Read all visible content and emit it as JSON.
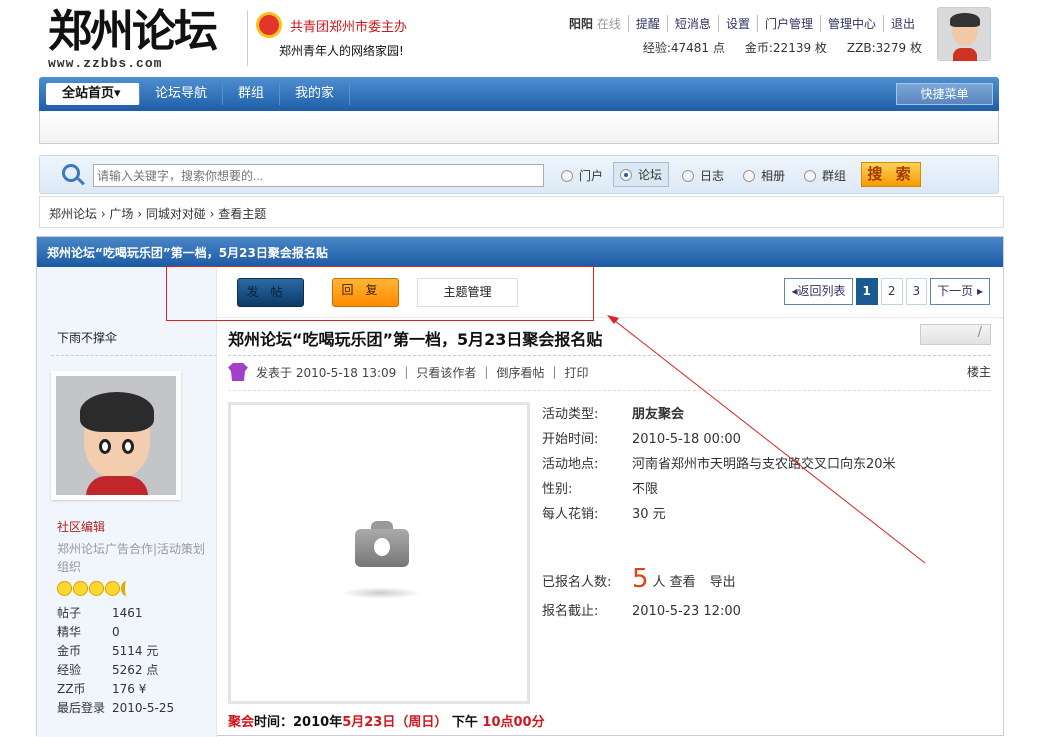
{
  "header": {
    "logo_text": "郑州论坛",
    "logo_url": "www.zzbbs.com",
    "org_line1": "共青团郑州市委主办",
    "org_line2": "郑州青年人的网络家园!",
    "user": {
      "name": "阳阳",
      "status": "在线",
      "links": [
        "提醒",
        "短消息",
        "设置",
        "门户管理",
        "管理中心",
        "退出"
      ],
      "exp": "经验:47481 点",
      "gold": "金币:22139 枚",
      "zzb": "ZZB:3279 枚"
    }
  },
  "nav": {
    "items": [
      "全站首页▾",
      "论坛导航",
      "群组",
      "我的家"
    ],
    "quick_menu": "快捷菜单"
  },
  "search": {
    "placeholder": "请输入关键字，搜索你想要的...",
    "options": [
      "门户",
      "论坛",
      "日志",
      "相册",
      "群组"
    ],
    "selected": "论坛",
    "button": "搜 索"
  },
  "breadcrumb": "郑州论坛 › 广场 › 同城对对碰 › 查看主题",
  "thread": {
    "header_title": "郑州论坛“吃喝玩乐团”第一档，5月23日聚会报名贴",
    "title": "郑州论坛“吃喝玩乐团”第一档，5月23日聚会报名贴",
    "buttons": {
      "post": "发帖",
      "reply": "回复",
      "manage": "主题管理"
    },
    "pager": {
      "back": "◂返回列表",
      "pages": [
        "1",
        "2",
        "3"
      ],
      "current": "1",
      "next": "下一页 ▸"
    },
    "edit_icon": "/",
    "meta": {
      "posted": "发表于 2010-5-18 13:09",
      "only_author": "只看该作者",
      "reverse": "倒序看帖",
      "print": "打印",
      "floor": "楼主"
    },
    "activity": [
      {
        "k": "活动类型:",
        "v": "朋友聚会"
      },
      {
        "k": "开始时间:",
        "v": "2010-5-18 00:00"
      },
      {
        "k": "活动地点:",
        "v": "河南省郑州市天明路与支农路交叉口向东20米"
      },
      {
        "k": "性别:",
        "v": "不限"
      },
      {
        "k": "每人花销:",
        "v": "30 元"
      }
    ],
    "signup": {
      "label": "已报名人数:",
      "count": "5",
      "unit": "人",
      "view": "查看",
      "export": "导出"
    },
    "deadline": {
      "k": "报名截止:",
      "v": "2010-5-23 12:00"
    },
    "tail": {
      "a": "聚会",
      "b": "时间：2010年",
      "c": "5月23日（周日）",
      "d": " 下午 ",
      "e": "10点00分"
    }
  },
  "author": {
    "name": "下雨不撑伞",
    "group": "社区编辑",
    "desc": "郑州论坛广告合作|活动策划组织",
    "stats": [
      {
        "k": "帖子",
        "v": "1461"
      },
      {
        "k": "精华",
        "v": "0"
      },
      {
        "k": "金币",
        "v": "5114 元"
      },
      {
        "k": "经验",
        "v": "5262 点"
      },
      {
        "k": "ZZ币",
        "v": "176 ¥"
      },
      {
        "k": "最后登录",
        "v": "2010-5-25"
      }
    ]
  },
  "colors": {
    "nav_blue": "#1e5ea8",
    "accent_red": "#d0161d",
    "annotation": "#dd2222"
  }
}
